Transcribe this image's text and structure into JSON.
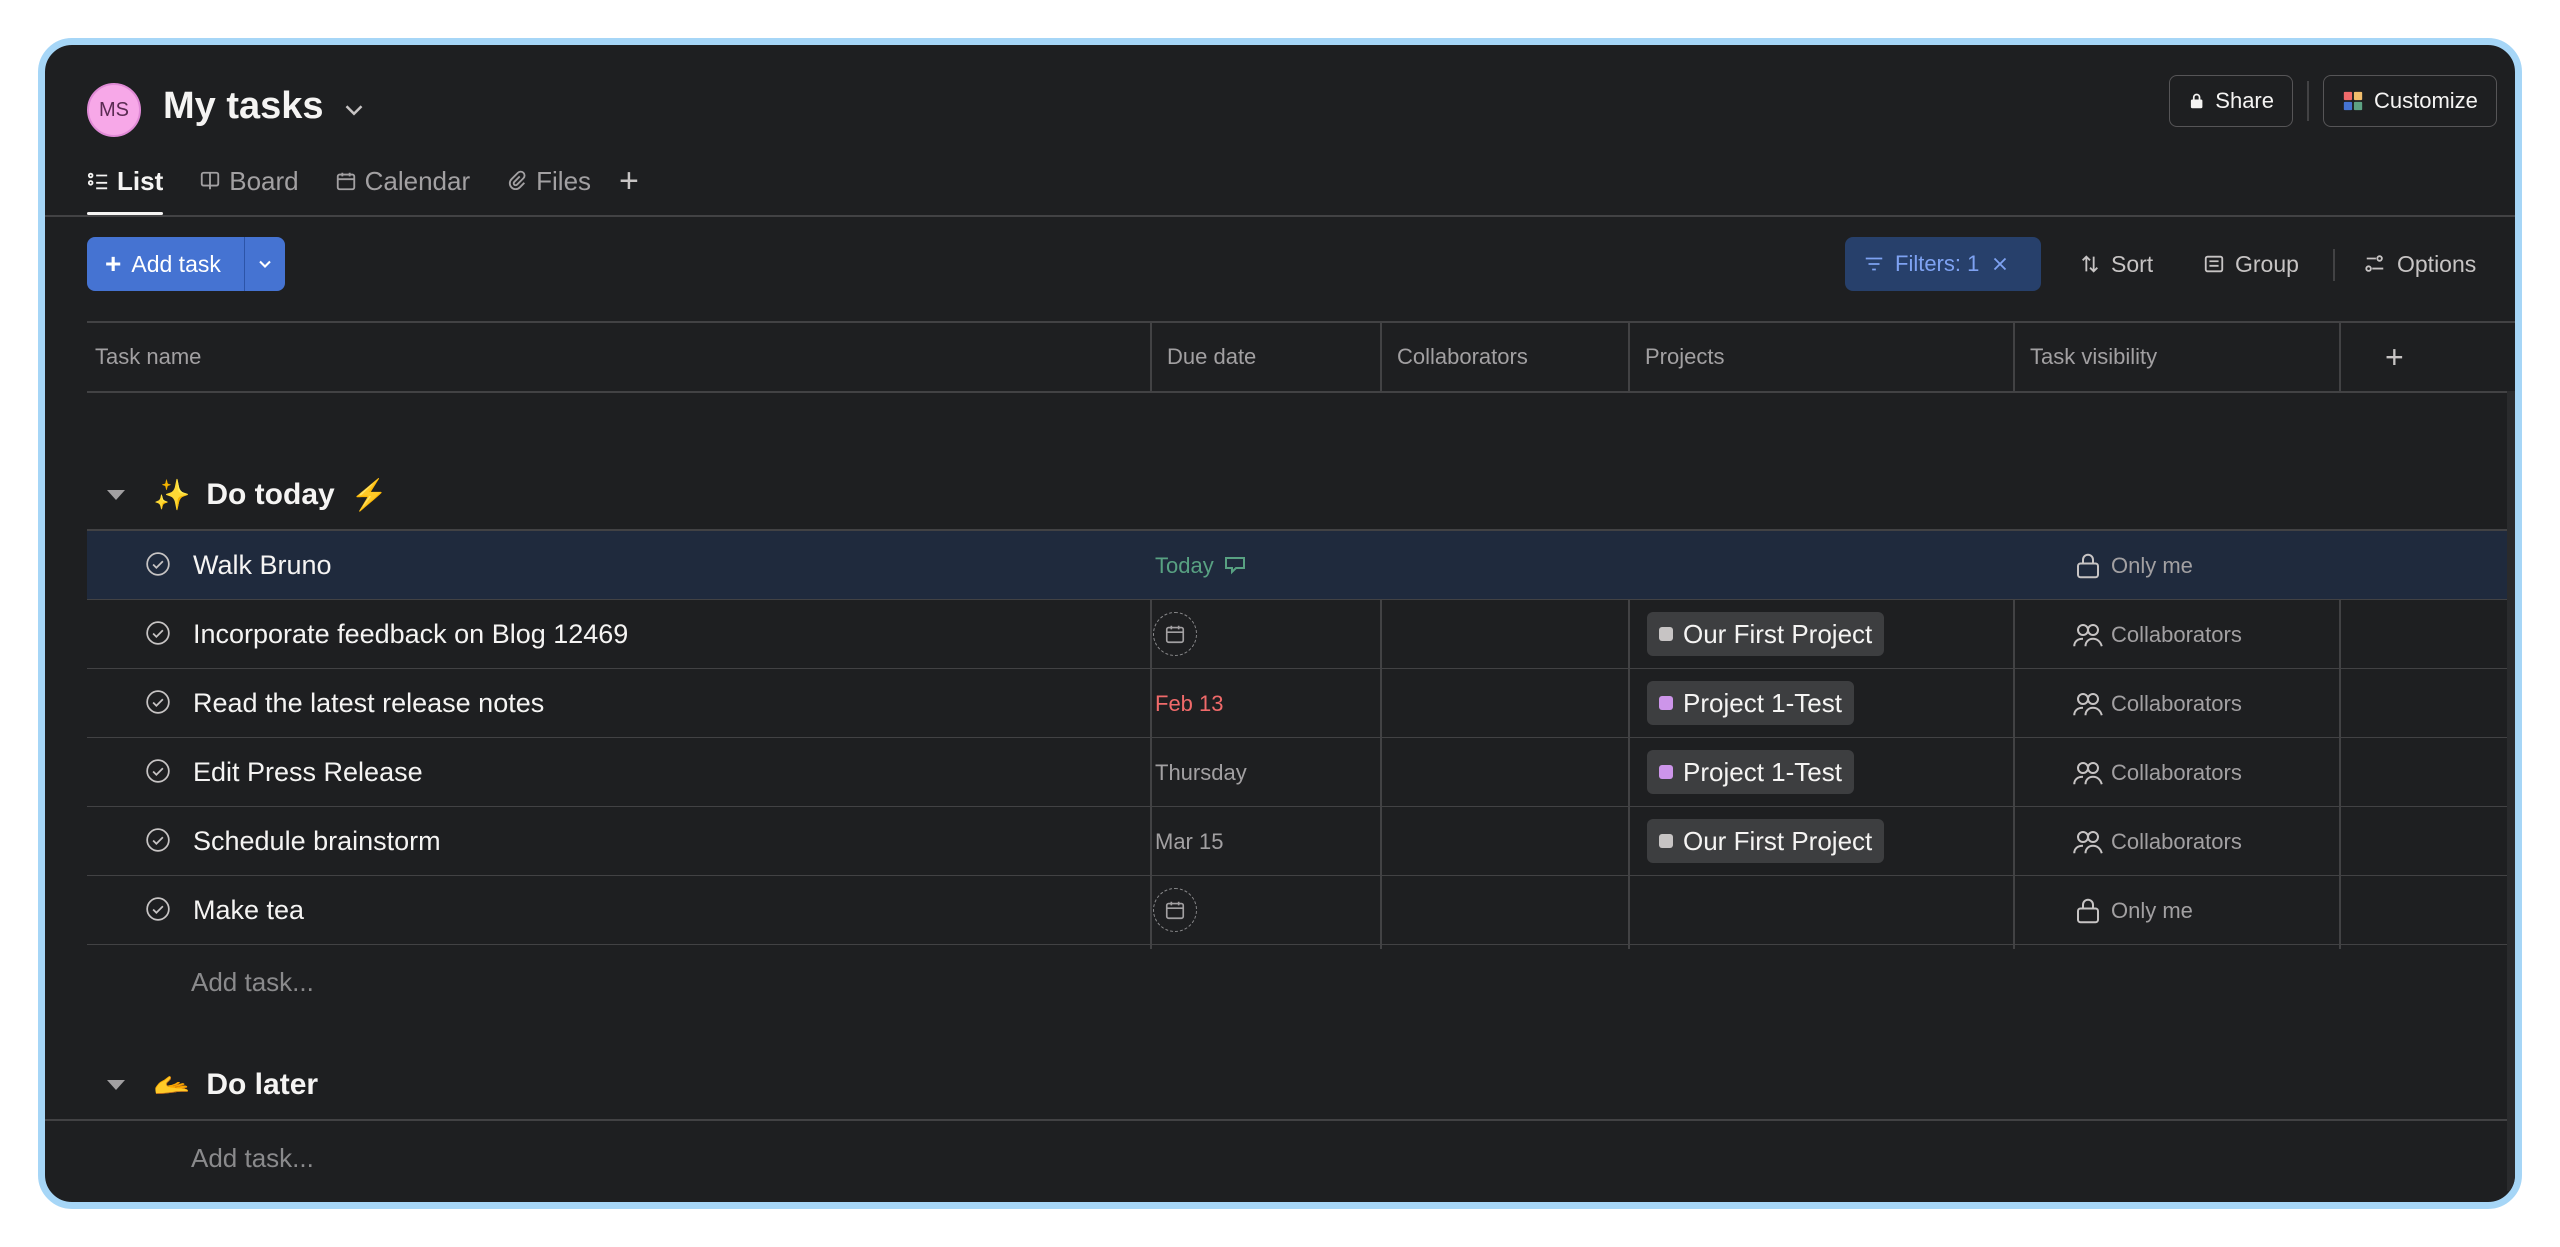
{
  "header": {
    "avatar_initials": "MS",
    "title": "My tasks",
    "share_label": "Share",
    "customize_label": "Customize"
  },
  "tabs": [
    {
      "label": "List",
      "active": true
    },
    {
      "label": "Board"
    },
    {
      "label": "Calendar"
    },
    {
      "label": "Files"
    }
  ],
  "toolbar": {
    "add_task_label": "Add task",
    "filters_label": "Filters: 1",
    "sort_label": "Sort",
    "group_label": "Group",
    "options_label": "Options"
  },
  "columns": [
    "Task name",
    "Due date",
    "Collaborators",
    "Projects",
    "Task visibility"
  ],
  "sections": [
    {
      "title": "Do today",
      "emoji_before": "✨",
      "emoji_after": "⚡",
      "tasks": [
        {
          "name": "Walk Bruno",
          "due": "Today",
          "due_state": "today",
          "project": "",
          "visibility": "Only me"
        },
        {
          "name": "Incorporate feedback on Blog 12469",
          "due": "",
          "project": "Our First Project",
          "project_color": "#c7c4c4",
          "visibility": "Collaborators"
        },
        {
          "name": "Read the latest release notes",
          "due": "Feb 13",
          "due_state": "overdue",
          "project": "Project 1-Test",
          "project_color": "#cd95ea",
          "visibility": "Collaborators"
        },
        {
          "name": "Edit Press Release",
          "due": "Thursday",
          "project": "Project 1-Test",
          "project_color": "#cd95ea",
          "visibility": "Collaborators"
        },
        {
          "name": "Schedule brainstorm",
          "due": "Mar 15",
          "project": "Our First Project",
          "project_color": "#c7c4c4",
          "visibility": "Collaborators"
        },
        {
          "name": "Make tea",
          "due": "",
          "project": "",
          "visibility": "Only me"
        }
      ],
      "add_task_placeholder": "Add task..."
    },
    {
      "title": "Do later",
      "emoji_before": "🫴",
      "add_task_placeholder": "Add task..."
    }
  ]
}
